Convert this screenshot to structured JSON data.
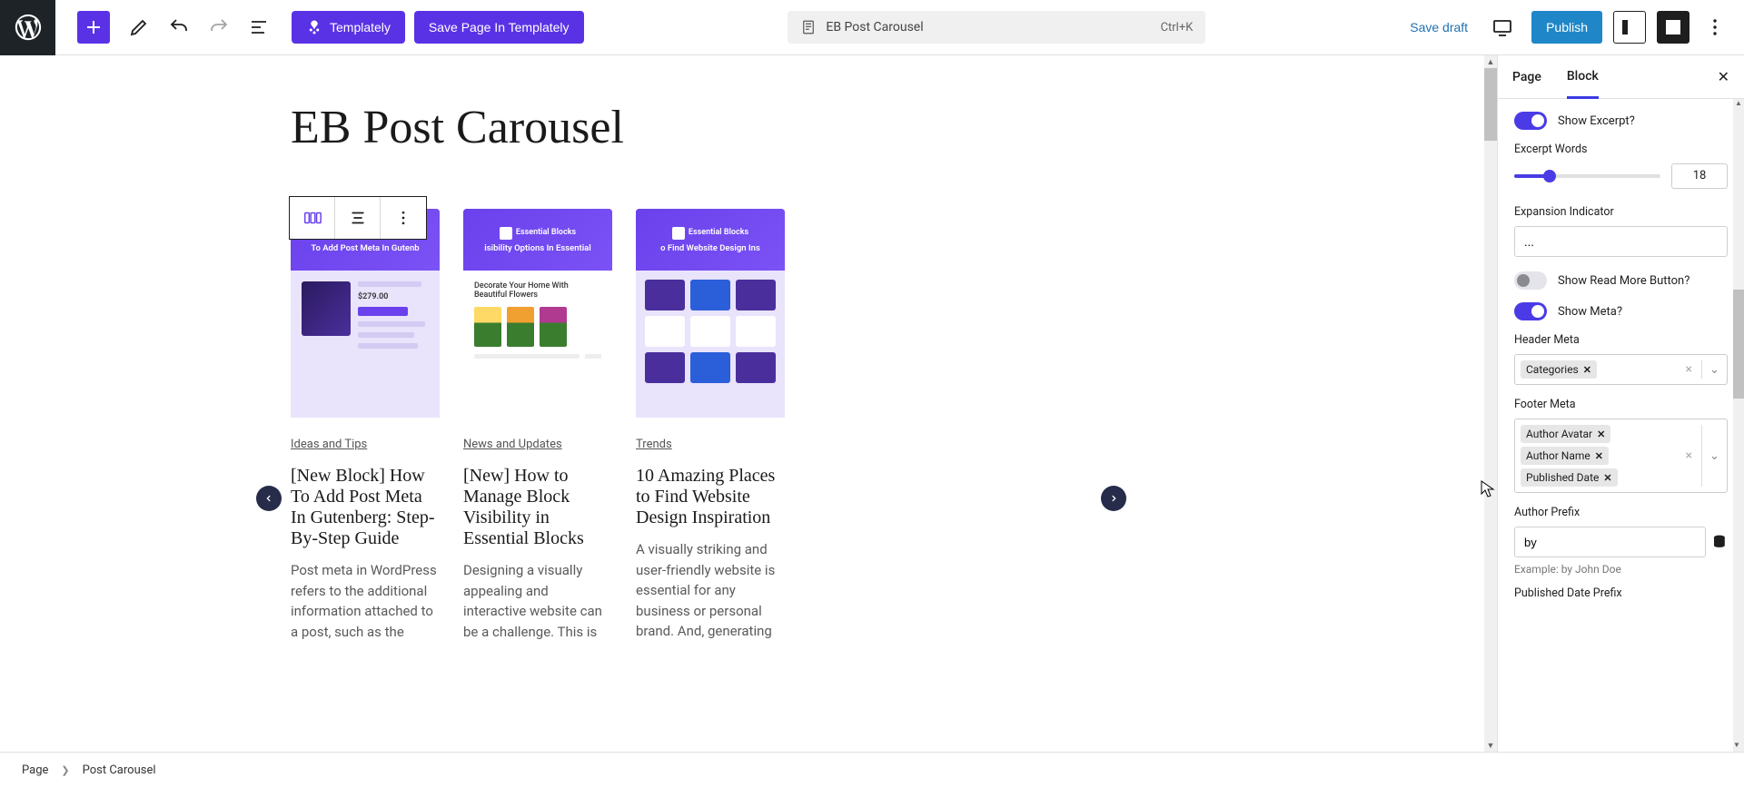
{
  "topbar": {
    "templately_label": "Templately",
    "save_templately_label": "Save Page In Templately",
    "doc_title": "EB Post Carousel",
    "shortcut": "Ctrl+K",
    "save_draft": "Save draft",
    "publish": "Publish"
  },
  "page": {
    "title": "EB Post Carousel"
  },
  "carousel": {
    "slides": [
      {
        "head_caption": "To Add Post Meta In Gutenb",
        "logo_text": "Essential\nBlocks",
        "category": "Ideas and Tips",
        "title": "[New Block] How To Add Post Meta In Gutenberg: Step-By-Step Guide",
        "excerpt": "Post meta in WordPress refers to the additional information attached to a post, such as the",
        "body_price": "$279.00"
      },
      {
        "head_caption": "isibility Options In Essential",
        "logo_text": "Essential\nBlocks",
        "category": "News and Updates",
        "title": "[New] How to Manage Block Visibility in Essential Blocks",
        "excerpt": "Designing a visually appealing and interactive website can be a challenge. This is",
        "body_text": "Decorate Your Home With Beautiful Flowers"
      },
      {
        "head_caption": "o Find Website Design Ins",
        "logo_text": "Essential\nBlocks",
        "category": "Trends",
        "title": "10 Amazing Places to Find Website Design Inspiration",
        "excerpt": "A visually striking and user-friendly website is essential for any business or personal brand. And, generating"
      }
    ]
  },
  "sidebar": {
    "tabs": {
      "page": "Page",
      "block": "Block"
    },
    "show_excerpt_label": "Show Excerpt?",
    "excerpt_words_label": "Excerpt Words",
    "excerpt_words_value": "18",
    "expansion_indicator_label": "Expansion Indicator",
    "expansion_indicator_value": "...",
    "show_read_more_label": "Show Read More Button?",
    "show_meta_label": "Show Meta?",
    "header_meta_label": "Header Meta",
    "header_meta_tags": [
      "Categories"
    ],
    "footer_meta_label": "Footer Meta",
    "footer_meta_tags": [
      "Author Avatar",
      "Author Name",
      "Published Date"
    ],
    "author_prefix_label": "Author Prefix",
    "author_prefix_value": "by",
    "author_prefix_example": "Example: by John Doe",
    "published_date_prefix_label": "Published Date Prefix"
  },
  "breadcrumb": {
    "page": "Page",
    "block": "Post Carousel"
  }
}
